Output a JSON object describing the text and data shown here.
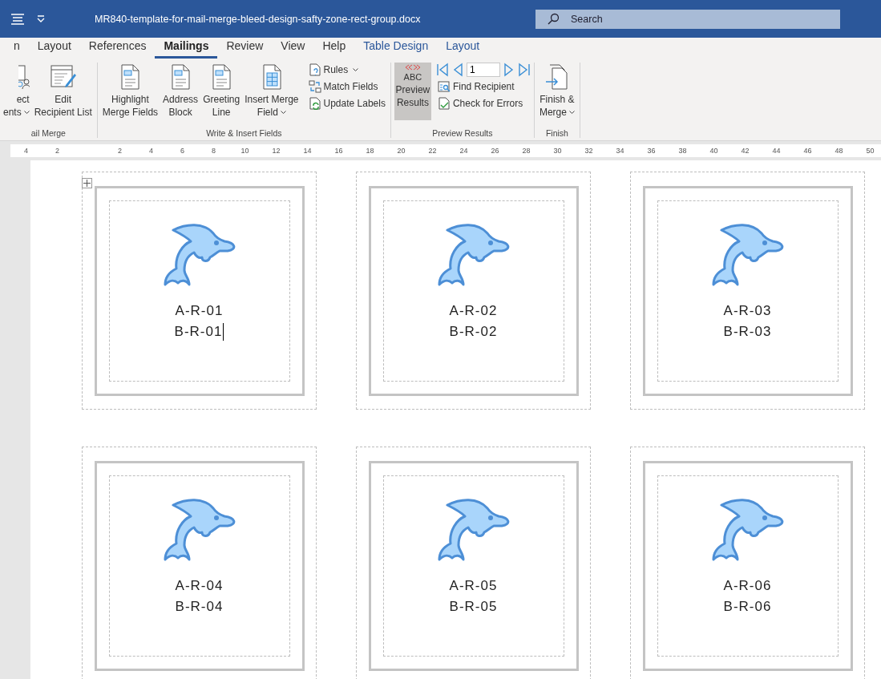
{
  "window": {
    "title": "MR840-template-for-mail-merge-bleed-design-safty-zone-rect-group.docx"
  },
  "search": {
    "placeholder": "Search"
  },
  "tabs": [
    {
      "label": "n",
      "selected": false,
      "kind": "standard"
    },
    {
      "label": "Layout",
      "selected": false,
      "kind": "standard"
    },
    {
      "label": "References",
      "selected": false,
      "kind": "standard"
    },
    {
      "label": "Mailings",
      "selected": true,
      "kind": "standard"
    },
    {
      "label": "Review",
      "selected": false,
      "kind": "standard"
    },
    {
      "label": "View",
      "selected": false,
      "kind": "standard"
    },
    {
      "label": "Help",
      "selected": false,
      "kind": "standard"
    },
    {
      "label": "Table Design",
      "selected": false,
      "kind": "contextual"
    },
    {
      "label": "Layout",
      "selected": false,
      "kind": "contextual"
    }
  ],
  "ribbon": {
    "groups": [
      {
        "label": "ail Merge",
        "items": [
          {
            "kind": "large",
            "label": "ect\nents",
            "dropdown": true
          },
          {
            "kind": "large",
            "label": "Edit\nRecipient List",
            "dropdown": false
          }
        ]
      },
      {
        "label": "Write & Insert Fields",
        "items": [
          {
            "kind": "large",
            "label": "Highlight\nMerge Fields",
            "dropdown": false
          },
          {
            "kind": "large",
            "label": "Address\nBlock",
            "dropdown": false
          },
          {
            "kind": "large",
            "label": "Greeting\nLine",
            "dropdown": false
          },
          {
            "kind": "large",
            "label": "Insert Merge\nField",
            "dropdown": true
          },
          {
            "kind": "stack",
            "entries": [
              {
                "label": "Rules",
                "dropdown": true
              },
              {
                "label": "Match Fields",
                "dropdown": false
              },
              {
                "label": "Update Labels",
                "dropdown": false
              }
            ]
          }
        ]
      },
      {
        "label": "Preview Results",
        "items": [
          {
            "kind": "toggle",
            "badge": "ABC",
            "label": "Preview\nResults",
            "selected": true
          },
          {
            "kind": "navigator",
            "record": "1",
            "entries": [
              {
                "label": "Find Recipient",
                "dropdown": false
              },
              {
                "label": "Check for Errors",
                "dropdown": false
              }
            ]
          }
        ]
      },
      {
        "label": "Finish",
        "items": [
          {
            "kind": "large",
            "label": "Finish &\nMerge",
            "dropdown": true
          }
        ]
      }
    ]
  },
  "ruler": {
    "numbers": [
      "4",
      "2",
      "2",
      "4",
      "6",
      "8",
      "10",
      "12",
      "14",
      "16",
      "18",
      "20",
      "22",
      "24",
      "26",
      "28",
      "30",
      "32",
      "34",
      "36",
      "38",
      "40",
      "42",
      "44",
      "46",
      "48",
      "50"
    ]
  },
  "labels": [
    {
      "line_1": "A-R-01",
      "line_2": "B-R-01",
      "cursor": true
    },
    {
      "line_1": "A-R-02",
      "line_2": "B-R-02",
      "cursor": false
    },
    {
      "line_1": "A-R-03",
      "line_2": "B-R-03",
      "cursor": false
    },
    {
      "line_1": "A-R-04",
      "line_2": "B-R-04",
      "cursor": false
    },
    {
      "line_1": "A-R-05",
      "line_2": "B-R-05",
      "cursor": false
    },
    {
      "line_1": "A-R-06",
      "line_2": "B-R-06",
      "cursor": false
    }
  ]
}
